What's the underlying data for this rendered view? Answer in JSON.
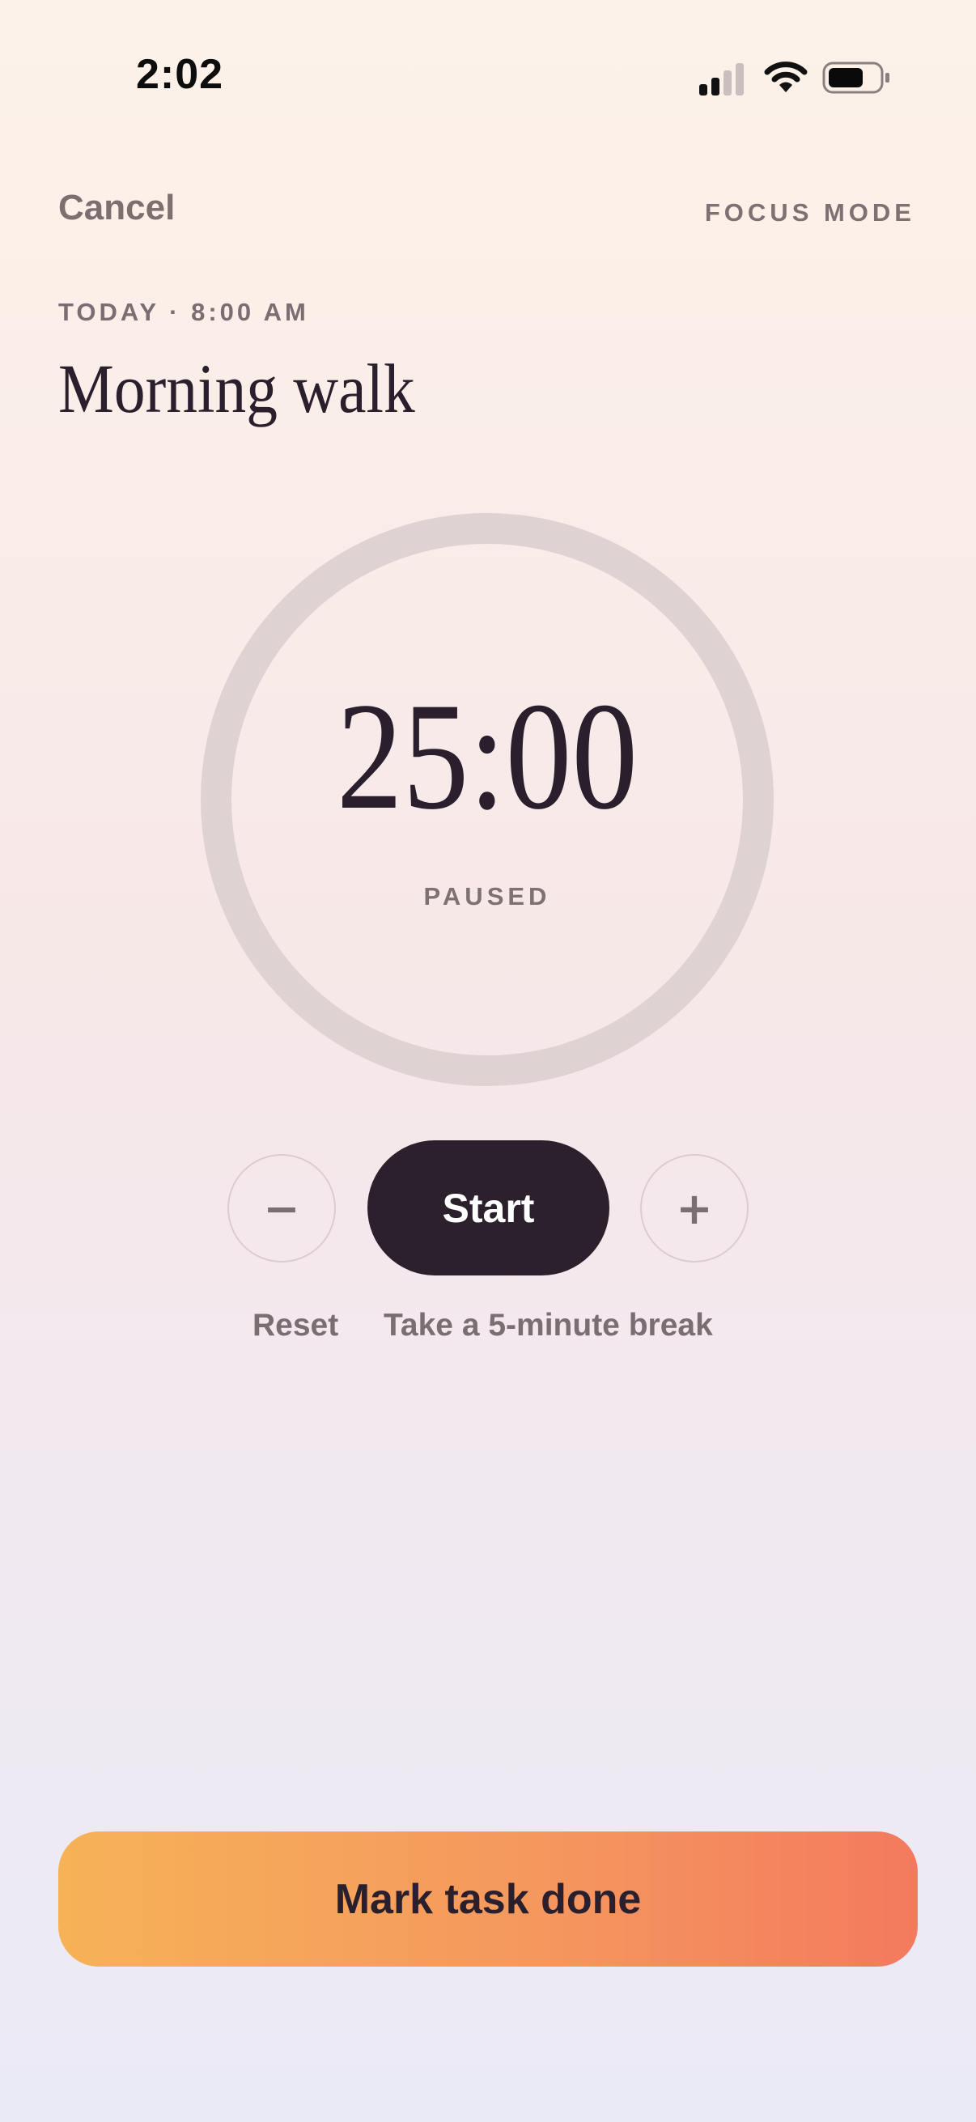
{
  "status_bar": {
    "time": "2:02",
    "icons": [
      "cellular-signal-icon",
      "wifi-icon",
      "battery-icon"
    ]
  },
  "header": {
    "cancel_label": "Cancel",
    "mode_label": "FOCUS MODE"
  },
  "task": {
    "date_line": "TODAY · 8:00 AM",
    "title": "Morning walk"
  },
  "timer": {
    "value": "25:00",
    "status": "PAUSED",
    "progress": 0
  },
  "controls": {
    "decrease_symbol": "−",
    "start_label": "Start",
    "increase_symbol": "+",
    "reset_label": "Reset",
    "break_label": "Take a 5-minute break"
  },
  "cta": {
    "done_label": "Mark task done"
  },
  "colors": {
    "ink": "#2a1f2d",
    "muted": "#7a6e72",
    "ring_track": "#dfd2d3",
    "cta_gradient_start": "#f6b257",
    "cta_gradient_end": "#f37a5e"
  }
}
